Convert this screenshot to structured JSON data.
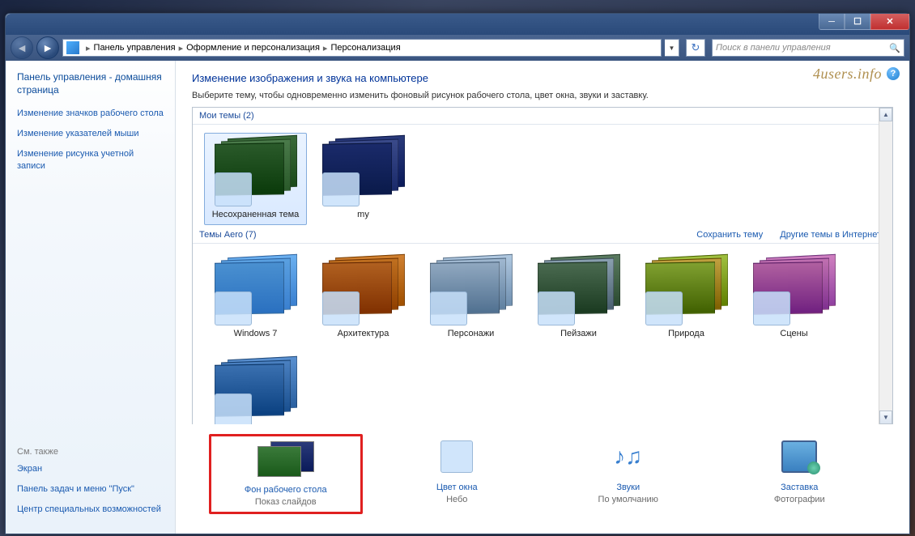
{
  "watermark": "4users.info",
  "breadcrumb": {
    "root": "Панель управления",
    "mid": "Оформление и персонализация",
    "leaf": "Персонализация"
  },
  "search": {
    "placeholder": "Поиск в панели управления"
  },
  "sidebar": {
    "home": "Панель управления - домашняя страница",
    "links": [
      "Изменение значков рабочего стола",
      "Изменение указателей мыши",
      "Изменение рисунка учетной записи"
    ],
    "also_label": "См. также",
    "also": [
      "Экран",
      "Панель задач и меню \"Пуск\"",
      "Центр специальных возможностей"
    ]
  },
  "main": {
    "title": "Изменение изображения и звука на компьютере",
    "desc": "Выберите тему, чтобы одновременно изменить фоновый рисунок рабочего стола, цвет окна, звуки и заставку.",
    "my_themes_label": "Мои темы (2)",
    "my_themes": [
      {
        "label": "Несохраненная тема",
        "selected": true,
        "cls": "bg-unsv"
      },
      {
        "label": "my",
        "selected": false,
        "cls": "bg-my"
      }
    ],
    "save_theme": "Сохранить тему",
    "more_themes": "Другие темы в Интернете",
    "aero_label": "Темы Aero (7)",
    "aero": [
      {
        "label": "Windows 7",
        "cls": "bg-win7"
      },
      {
        "label": "Архитектура",
        "cls": "bg-arch"
      },
      {
        "label": "Персонажи",
        "cls": "bg-char"
      },
      {
        "label": "Пейзажи",
        "cls": "bg-land"
      },
      {
        "label": "Природа",
        "cls": "bg-nat"
      },
      {
        "label": "Сцены",
        "cls": "bg-scene"
      }
    ],
    "bottom": [
      {
        "title": "Фон рабочего стола",
        "sub": "Показ слайдов",
        "hl": true,
        "icon": "bg"
      },
      {
        "title": "Цвет окна",
        "sub": "Небо",
        "hl": false,
        "icon": "color"
      },
      {
        "title": "Звуки",
        "sub": "По умолчанию",
        "hl": false,
        "icon": "sound"
      },
      {
        "title": "Заставка",
        "sub": "Фотографии",
        "hl": false,
        "icon": "scr"
      }
    ]
  }
}
